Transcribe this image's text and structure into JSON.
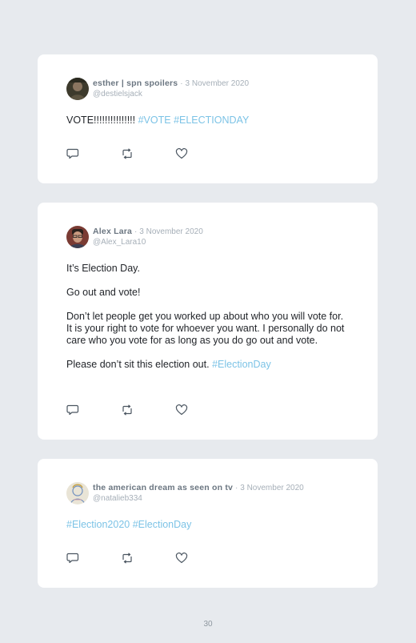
{
  "posts": [
    {
      "name": "esther | spn spoilers",
      "separator": "·",
      "date": "3 November 2020",
      "handle": "@destielsjack",
      "paragraphs": [
        {
          "text": "VOTE!!!!!!!!!!!!!!! ",
          "tags": "#VOTE #ELECTIONDAY"
        }
      ],
      "avatar_icon": "avatar-photo"
    },
    {
      "name": "Alex Lara",
      "separator": "·",
      "date": "3 November 2020",
      "handle": "@Alex_Lara10",
      "paragraphs": [
        {
          "text": "It’s Election Day."
        },
        {
          "text": "Go out and vote!"
        },
        {
          "text": "Don’t let people get you worked up about who you will vote for. It is your right to vote for whoever you want. I personally do not care who you vote for as long as you do go out and vote."
        },
        {
          "text": "Please don’t sit this election out. ",
          "tags": "#ElectionDay"
        }
      ],
      "avatar_icon": "avatar-photo"
    },
    {
      "name": "the american dream as seen on tv",
      "separator": "·",
      "date": "3 November 2020",
      "handle": "@natalieb334",
      "paragraphs": [
        {
          "tags": "#Election2020 #ElectionDay"
        }
      ],
      "avatar_icon": "avatar-illustration"
    }
  ],
  "actions": {
    "icons": [
      "reply-icon",
      "retweet-icon",
      "like-icon"
    ]
  },
  "page_number": "30",
  "colors": {
    "background": "#e7eaee",
    "card": "#ffffff",
    "name": "#6b7681",
    "muted": "#a6afb8",
    "text": "#22252a",
    "hashtag": "#7cc3e6"
  }
}
